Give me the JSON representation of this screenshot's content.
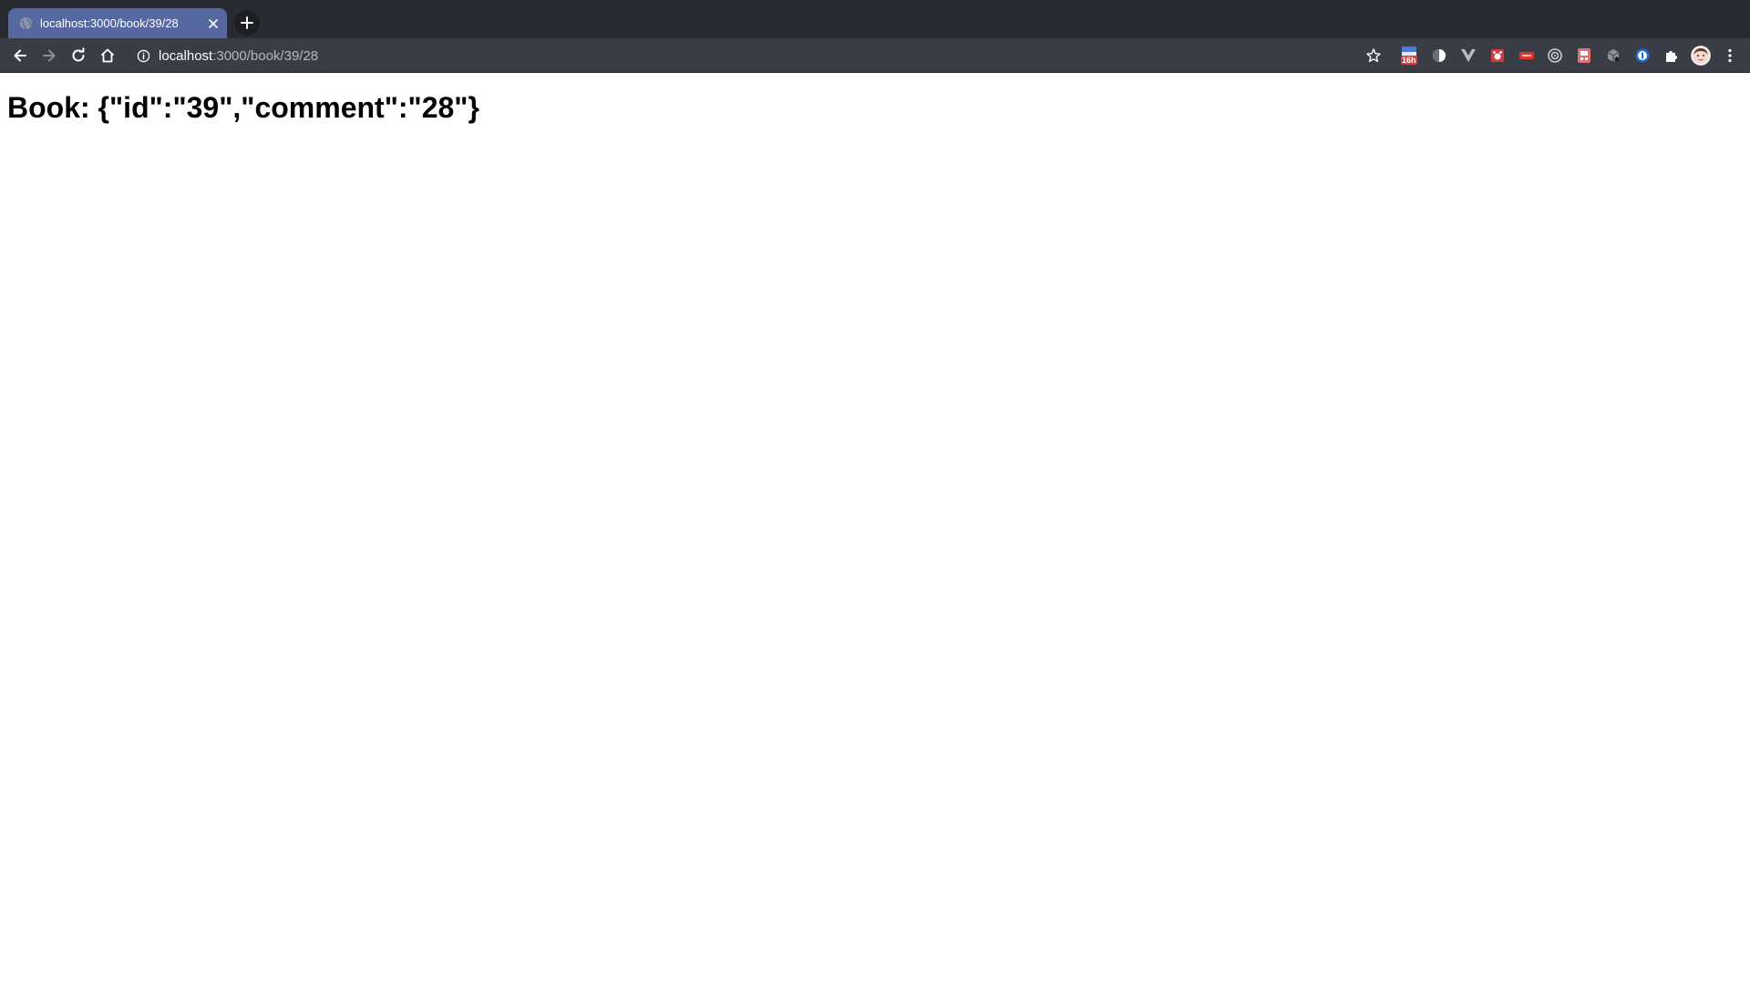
{
  "browser": {
    "tab": {
      "title": "localhost:3000/book/39/28",
      "favicon": "globe-icon",
      "close_icon": "close-icon"
    },
    "new_tab_icon": "plus-icon",
    "toolbar": {
      "back_icon": "back-arrow-icon",
      "forward_icon": "forward-arrow-icon",
      "reload_icon": "reload-icon",
      "home_icon": "home-icon",
      "site_info_icon": "info-icon",
      "address": {
        "host": "localhost",
        "path": ":3000/book/39/28"
      },
      "bookmark_icon": "star-icon",
      "extensions": [
        "calendar-extension-icon",
        "circle-extension-icon",
        "vue-devtools-icon",
        "red-extension-icon",
        "red-bar-extension-icon",
        "target-extension-icon",
        "red-box-extension-icon",
        "cube-extension-icon",
        "password-manager-icon",
        "puzzle-icon"
      ],
      "calendar_badge": "16h",
      "avatar": "profile-avatar",
      "menu_icon": "kebab-menu-icon"
    },
    "colors": {
      "tabstrip_bg": "#292b33",
      "active_tab_bg": "#55689f",
      "toolbar_bg": "#3b3d46"
    }
  },
  "page": {
    "heading": "Book: {\"id\":\"39\",\"comment\":\"28\"}"
  }
}
